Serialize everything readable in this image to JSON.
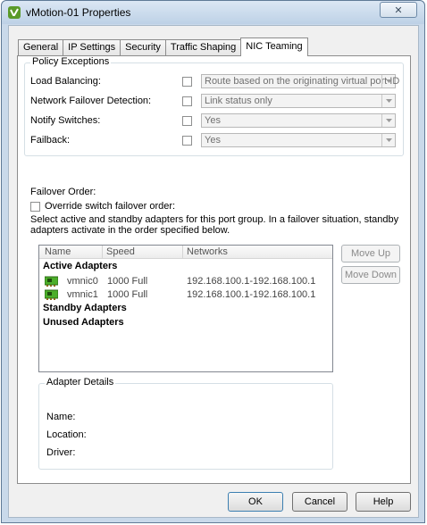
{
  "window": {
    "title": "vMotion-01 Properties",
    "close_glyph": "✕"
  },
  "tabs": [
    {
      "label": "General"
    },
    {
      "label": "IP Settings"
    },
    {
      "label": "Security"
    },
    {
      "label": "Traffic Shaping"
    },
    {
      "label": "NIC Teaming"
    }
  ],
  "policy": {
    "group_label": "Policy Exceptions",
    "rows": [
      {
        "label": "Load Balancing:",
        "value": "Route based on the originating virtual port ID",
        "checked": false
      },
      {
        "label": "Network Failover Detection:",
        "value": "Link status only",
        "checked": false
      },
      {
        "label": "Notify Switches:",
        "value": "Yes",
        "checked": false
      },
      {
        "label": "Failback:",
        "value": "Yes",
        "checked": false
      }
    ]
  },
  "failover": {
    "heading": "Failover Order:",
    "override_label": "Override switch failover order:",
    "description_line1": "Select active and standby adapters for this port group.  In a failover situation, standby",
    "description_line2": "adapters activate  in the order specified below."
  },
  "adapters_list": {
    "columns": [
      "Name",
      "Speed",
      "Networks"
    ],
    "groups": {
      "active": "Active Adapters",
      "standby": "Standby Adapters",
      "unused": "Unused Adapters"
    },
    "active_rows": [
      {
        "name": "vmnic0",
        "speed": "1000 Full",
        "networks": "192.168.100.1-192.168.100.1"
      },
      {
        "name": "vmnic1",
        "speed": "1000 Full",
        "networks": "192.168.100.1-192.168.100.1"
      }
    ]
  },
  "move_buttons": {
    "up": "Move Up",
    "down": "Move Down"
  },
  "details": {
    "group_label": "Adapter Details",
    "name_label": "Name:",
    "location_label": "Location:",
    "driver_label": "Driver:"
  },
  "footer": {
    "ok": "OK",
    "cancel": "Cancel",
    "help": "Help"
  },
  "colors": {
    "window_frame": "#c9d9ea",
    "nic_icon_green": "#4caf2a"
  }
}
